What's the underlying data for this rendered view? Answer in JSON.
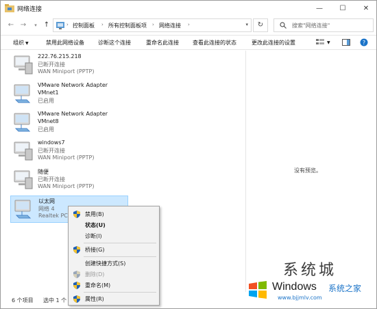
{
  "window": {
    "title": "网络连接"
  },
  "address": {
    "crumbs": [
      "控制面板",
      "所有控制面板项",
      "网络连接"
    ],
    "search_placeholder": "搜索\"网络连接\""
  },
  "commands": [
    "组织",
    "禁用此网络设备",
    "诊断这个连接",
    "重命名此连接",
    "查看此连接的状态",
    "更改此连接的设置"
  ],
  "connections": [
    {
      "name": "222.76.215.218",
      "status": "已断开连接",
      "device": "WAN Miniport (PPTP)",
      "type": "wan"
    },
    {
      "name": "VMware Network Adapter",
      "status": "VMnet1",
      "device": "已启用",
      "type": "vm"
    },
    {
      "name": "VMware Network Adapter",
      "status": "VMnet8",
      "device": "已启用",
      "type": "vm"
    },
    {
      "name": "windows7",
      "status": "已断开连接",
      "device": "WAN Miniport (PPTP)",
      "type": "wan"
    },
    {
      "name": "随便",
      "status": "已断开连接",
      "device": "WAN Miniport (PPTP)",
      "type": "wan"
    },
    {
      "name": "以太网",
      "status": "网络 4",
      "device": "Realtek PCI",
      "type": "eth",
      "selected": true
    }
  ],
  "preview": {
    "text": "没有预览。"
  },
  "status": {
    "count": "6 个项目",
    "selected": "选中 1 个"
  },
  "context_menu": {
    "items": [
      {
        "label": "禁用(B)",
        "shield": true
      },
      {
        "label": "状态(U)",
        "bold": true
      },
      {
        "label": "诊断(I)"
      },
      {
        "label": "桥接(G)",
        "shield": true
      },
      {
        "label": "创建快捷方式(S)"
      },
      {
        "label": "删除(D)",
        "shield": true,
        "disabled": true
      },
      {
        "label": "重命名(M)",
        "shield": true
      },
      {
        "label": "属性(R)",
        "shield": true
      }
    ]
  },
  "watermark": {
    "title": "系统城",
    "brand": "Windows",
    "brand_cn": "系统之家",
    "url": "www.bjjmlv.com"
  },
  "colors": {
    "selection": "#cce8ff",
    "accent": "#1a73c8"
  }
}
